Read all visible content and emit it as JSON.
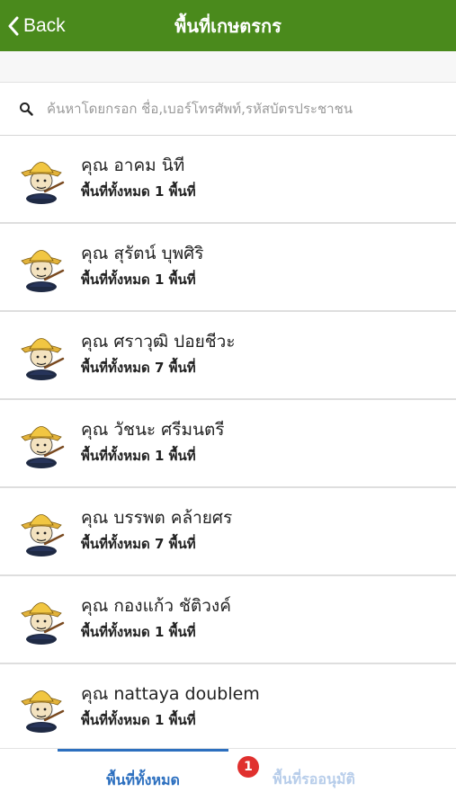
{
  "nav": {
    "back_label": "Back",
    "title": "พื้นที่เกษตรกร",
    "bar_color": "#4a8a1c"
  },
  "search": {
    "placeholder": "ค้นหาโดยกรอก ชื่อ,เบอร์โทรศัพท์,รหัสบัตรประชาชน",
    "value": "",
    "icon": "search-icon"
  },
  "farmers": [
    {
      "name": "คุณ อาคม นิที",
      "area": "พื้นที่ทั้งหมด 1 พื้นที่",
      "icon": "farmer-avatar-icon"
    },
    {
      "name": "คุณ สุรัตน์ บุพศิริ",
      "area": "พื้นที่ทั้งหมด 1 พื้นที่",
      "icon": "farmer-avatar-icon"
    },
    {
      "name": "คุณ ศราวุฒิ ปอยชีวะ",
      "area": "พื้นที่ทั้งหมด 7 พื้นที่",
      "icon": "farmer-avatar-icon"
    },
    {
      "name": "คุณ วัชนะ ศรีมนตรี",
      "area": "พื้นที่ทั้งหมด 1 พื้นที่",
      "icon": "farmer-avatar-icon"
    },
    {
      "name": "คุณ บรรพต คล้ายศร",
      "area": "พื้นที่ทั้งหมด 7 พื้นที่",
      "icon": "farmer-avatar-icon"
    },
    {
      "name": "คุณ กองแก้ว ชัติวงค์",
      "area": "พื้นที่ทั้งหมด 1 พื้นที่",
      "icon": "farmer-avatar-icon"
    },
    {
      "name": "คุณ nattaya doublem",
      "area": "พื้นที่ทั้งหมด 1 พื้นที่",
      "icon": "farmer-avatar-icon"
    }
  ],
  "tabs": {
    "all_label": "พื้นที่ทั้งหมด",
    "pending_label": "พื้นที่รออนุมัติ",
    "pending_badge": "1",
    "active_color": "#2c6fbf",
    "badge_color": "#e0302e"
  }
}
